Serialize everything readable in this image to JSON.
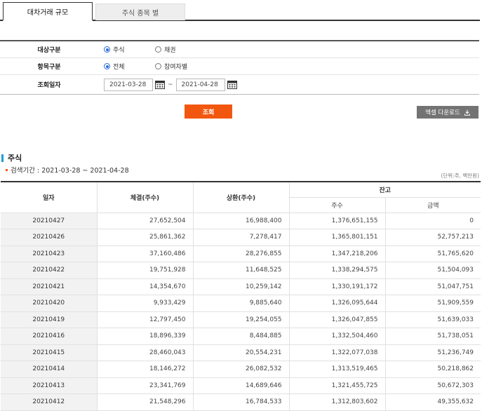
{
  "tabs": [
    {
      "label": "대차거래 규모",
      "active": true
    },
    {
      "label": "주식 종목 별",
      "active": false
    }
  ],
  "form": {
    "target": {
      "label": "대상구분",
      "options": [
        {
          "label": "주식",
          "checked": true
        },
        {
          "label": "채권",
          "checked": false
        }
      ]
    },
    "item": {
      "label": "항목구분",
      "options": [
        {
          "label": "전체",
          "checked": true
        },
        {
          "label": "참여자별",
          "checked": false
        }
      ]
    },
    "date": {
      "label": "조회일자",
      "from": "2021-03-28",
      "to": "2021-04-28",
      "separator": "~"
    }
  },
  "buttons": {
    "search": "조회",
    "excel": "엑셀 다운로드"
  },
  "section": {
    "title": "주식",
    "period_label": "검색기간 : 2021-03-28 ~ 2021-04-28",
    "unit": "(단위:주, 백만원)"
  },
  "table": {
    "headers": {
      "date": "일자",
      "settle": "체결(주수)",
      "repay": "상환(주수)",
      "balance": "잔고",
      "shares": "주수",
      "amount": "금액"
    },
    "rows": [
      [
        "20210427",
        "27,652,504",
        "16,988,400",
        "1,376,651,155",
        "0"
      ],
      [
        "20210426",
        "25,861,362",
        "7,278,417",
        "1,365,801,151",
        "52,757,213"
      ],
      [
        "20210423",
        "37,160,486",
        "28,276,855",
        "1,347,218,206",
        "51,765,620"
      ],
      [
        "20210422",
        "19,751,928",
        "11,648,525",
        "1,338,294,575",
        "51,504,093"
      ],
      [
        "20210421",
        "14,354,670",
        "10,259,142",
        "1,330,191,172",
        "51,047,751"
      ],
      [
        "20210420",
        "9,933,429",
        "9,885,640",
        "1,326,095,644",
        "51,909,559"
      ],
      [
        "20210419",
        "12,797,450",
        "19,254,055",
        "1,326,047,855",
        "51,639,033"
      ],
      [
        "20210416",
        "18,896,339",
        "8,484,885",
        "1,332,504,460",
        "51,738,051"
      ],
      [
        "20210415",
        "28,460,043",
        "20,554,231",
        "1,322,077,038",
        "51,236,749"
      ],
      [
        "20210414",
        "18,146,272",
        "26,082,532",
        "1,313,519,465",
        "50,218,862"
      ],
      [
        "20210413",
        "23,341,769",
        "14,689,646",
        "1,321,455,725",
        "50,672,303"
      ],
      [
        "20210412",
        "21,548,296",
        "16,784,533",
        "1,312,803,602",
        "49,355,632"
      ]
    ]
  },
  "colors": {
    "accent": "#f2570f",
    "title_bar": "#1a9fd8",
    "radio": "#2a6bd6",
    "excel_button": "#737373"
  }
}
